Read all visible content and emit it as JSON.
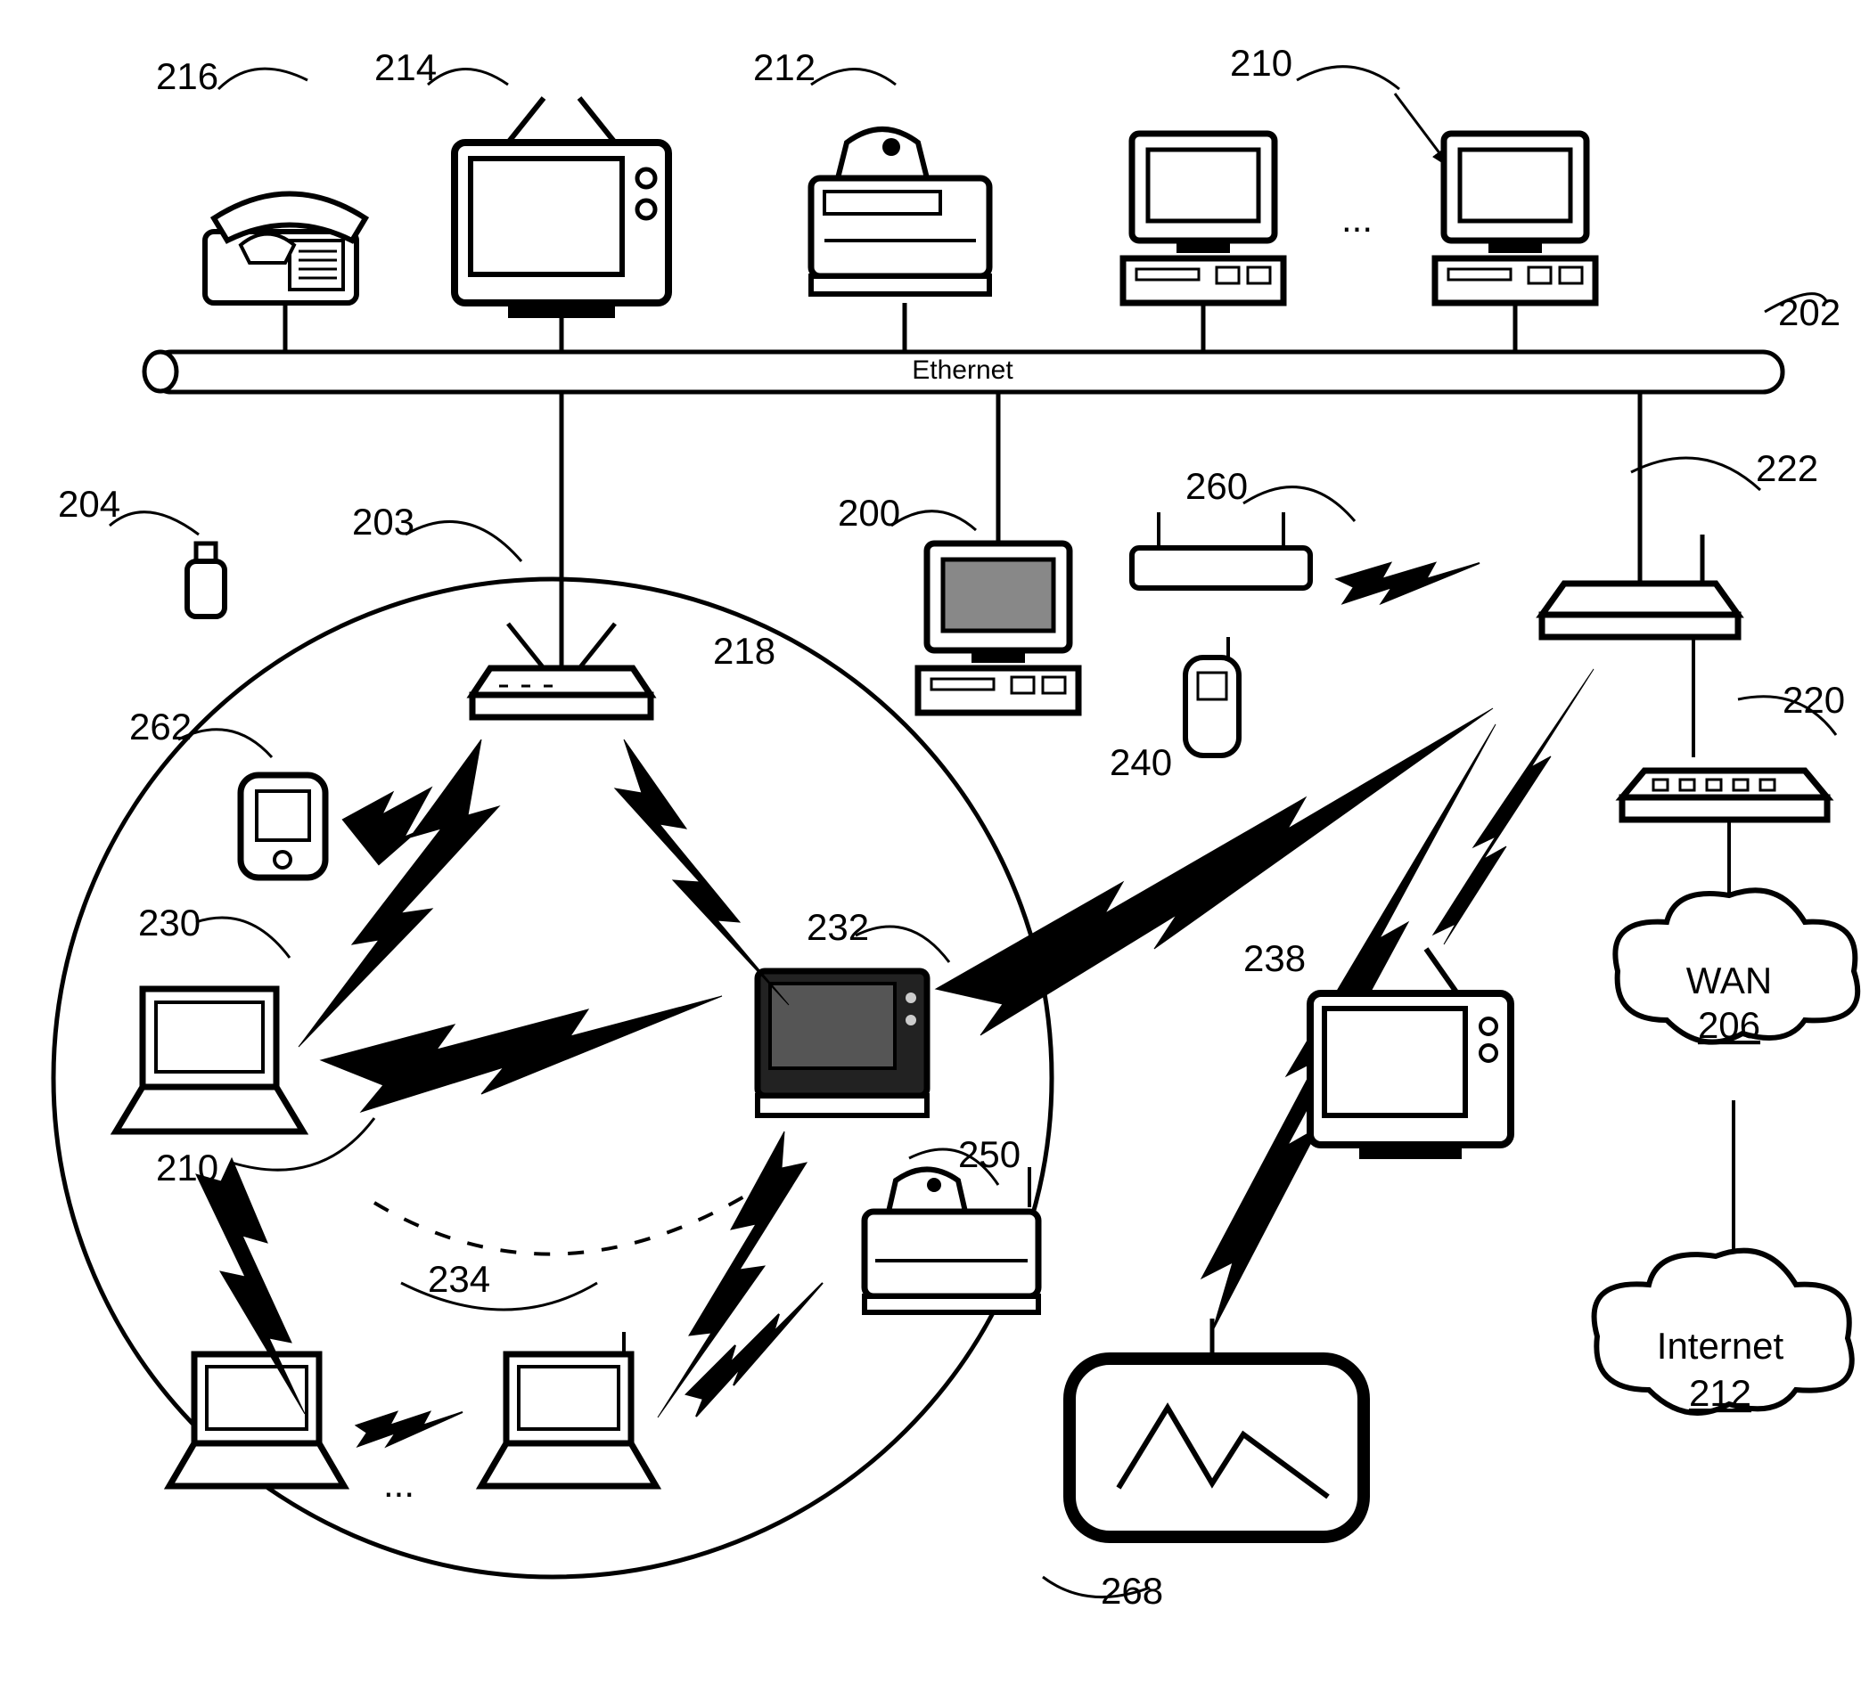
{
  "labels": {
    "ethernet": "Ethernet",
    "wan": "WAN",
    "wan_num": "206",
    "internet": "Internet",
    "internet_num": "212",
    "r216": "216",
    "r214": "214",
    "r212": "212",
    "r210_top": "210",
    "r202": "202",
    "r204": "204",
    "r203": "203",
    "r200": "200",
    "r218": "218",
    "r260": "260",
    "r222": "222",
    "r220": "220",
    "r240": "240",
    "r262": "262",
    "r230": "230",
    "r232": "232",
    "r238": "238",
    "r234": "234",
    "r250": "250",
    "r210_left": "210",
    "r268": "268",
    "dots_top": "...",
    "dots_bottom": "..."
  }
}
